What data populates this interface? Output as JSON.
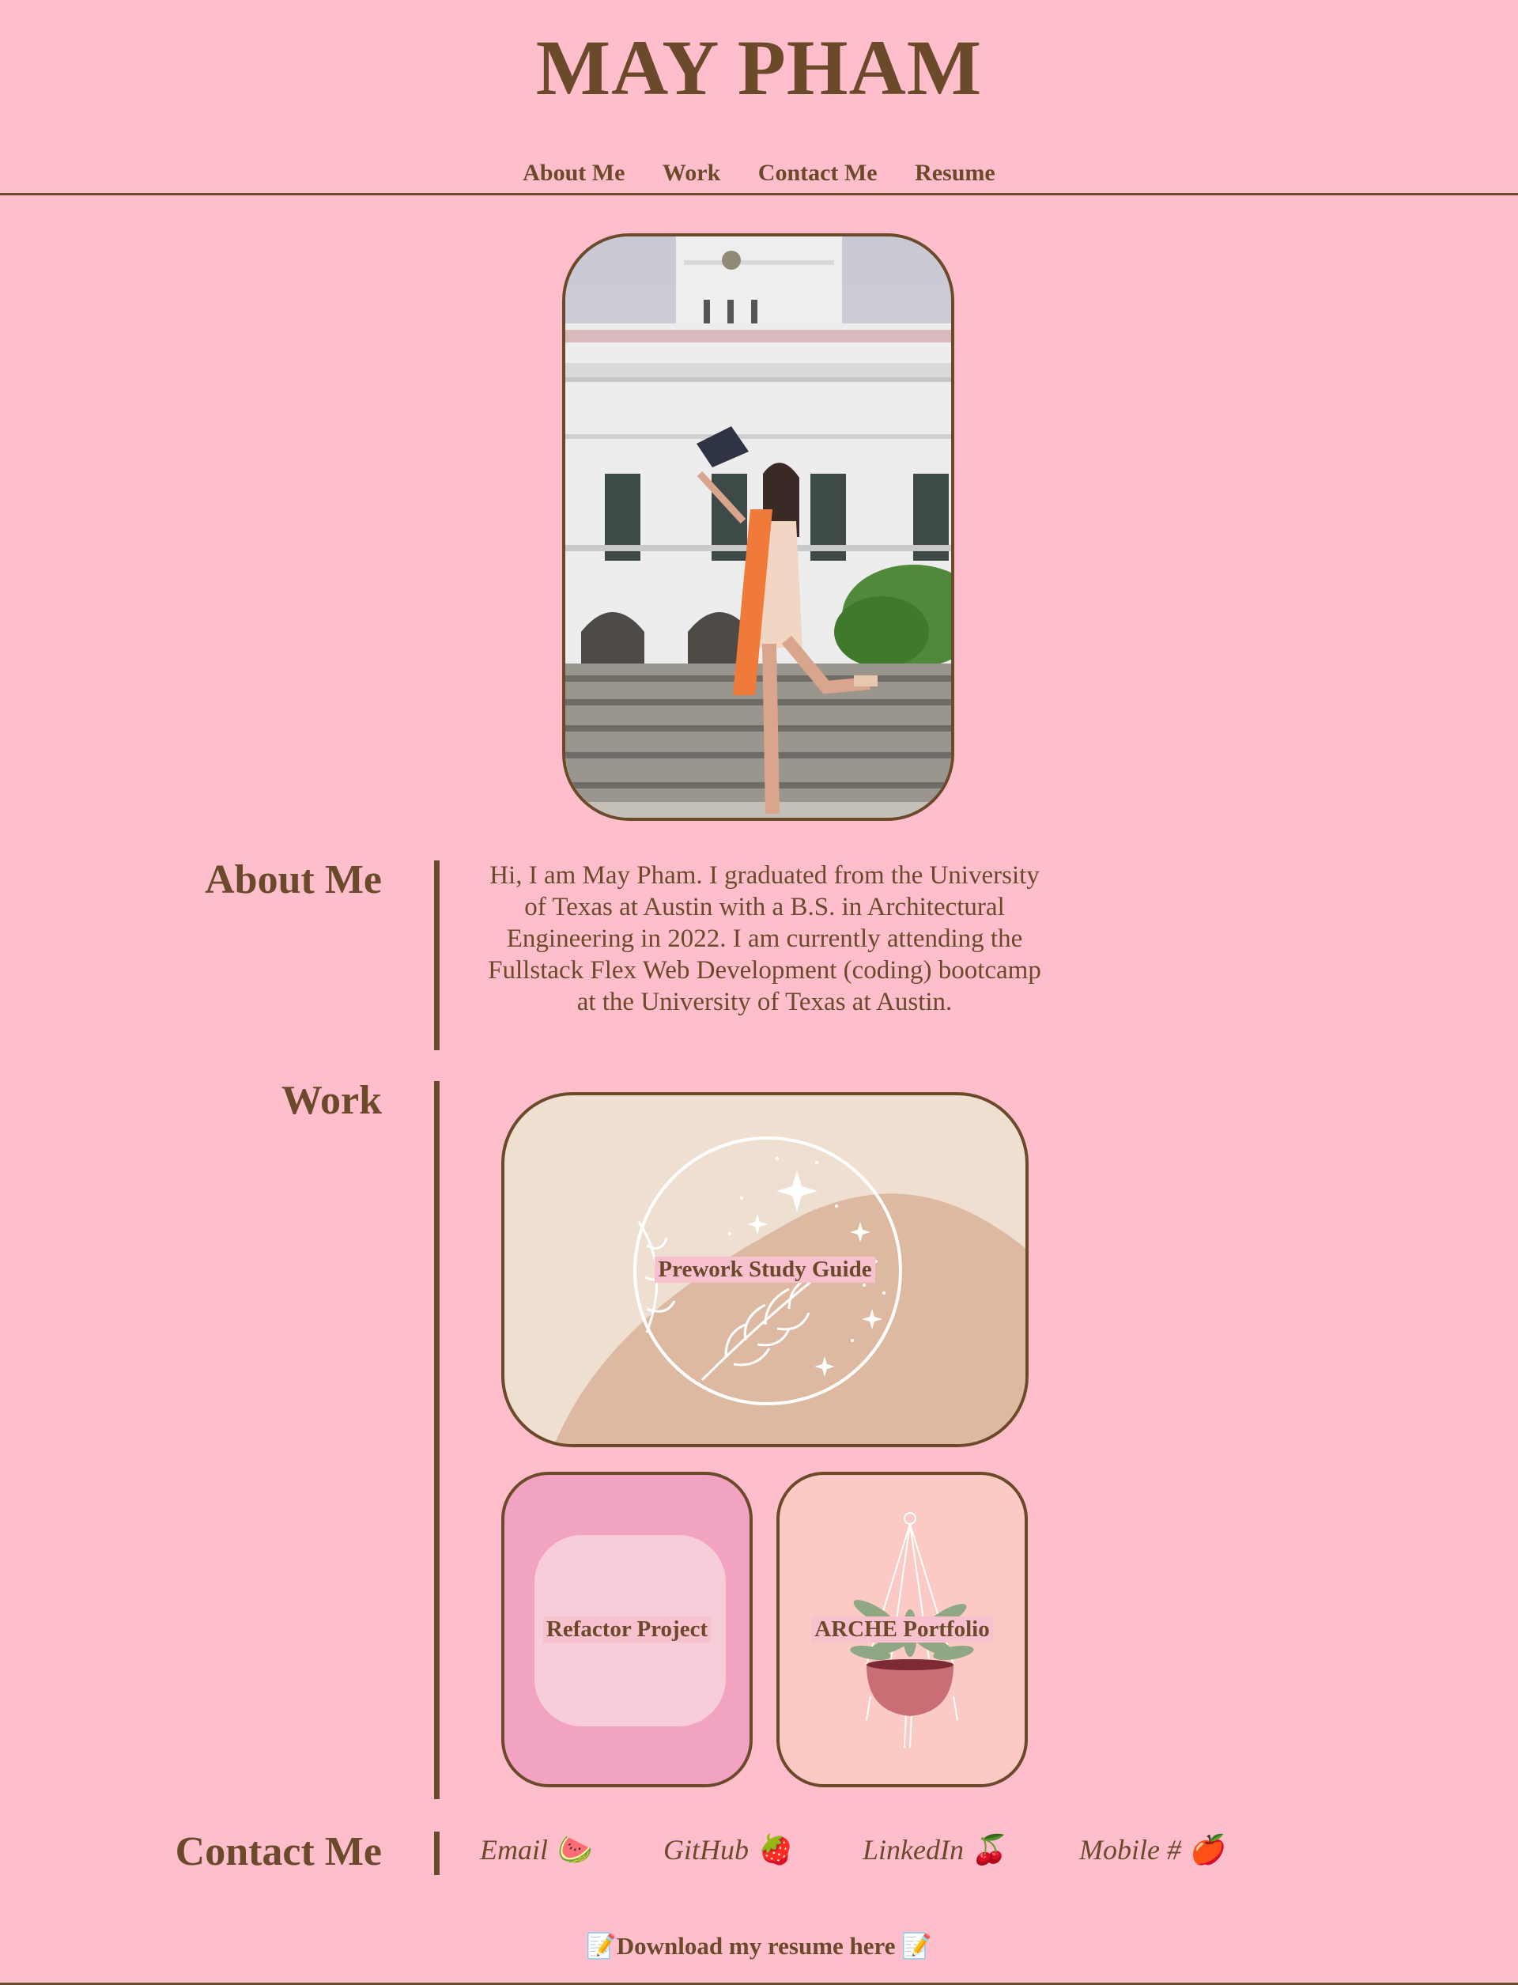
{
  "header": {
    "title": "MAY PHAM",
    "nav": [
      "About Me",
      "Work",
      "Contact Me",
      "Resume"
    ]
  },
  "about": {
    "heading": "About Me",
    "text": "Hi, I am May Pham. I graduated from the University of Texas at Austin with a B.S. in Architectural Engineering in 2022. I am currently attending the Fullstack Flex Web Development (coding) bootcamp at the University of Texas at Austin."
  },
  "work": {
    "heading": "Work",
    "projects": [
      {
        "label": "Prework Study Guide"
      },
      {
        "label": "Refactor Project"
      },
      {
        "label": "ARCHE Portfolio"
      }
    ]
  },
  "contact": {
    "heading": "Contact Me",
    "links": [
      {
        "label": "Email",
        "emoji": "🍉"
      },
      {
        "label": "GitHub",
        "emoji": "🍓"
      },
      {
        "label": "LinkedIn",
        "emoji": "🍒"
      },
      {
        "label": "Mobile #",
        "emoji": "🍎"
      }
    ]
  },
  "footer": {
    "icon": "📝",
    "label": "Download my resume here"
  },
  "colors": {
    "background": "#ffbecb",
    "text": "#6b4a2c",
    "card_beige": "#efdfd1",
    "card_pink": "#f2a3c2",
    "card_peach": "#fccac4"
  }
}
